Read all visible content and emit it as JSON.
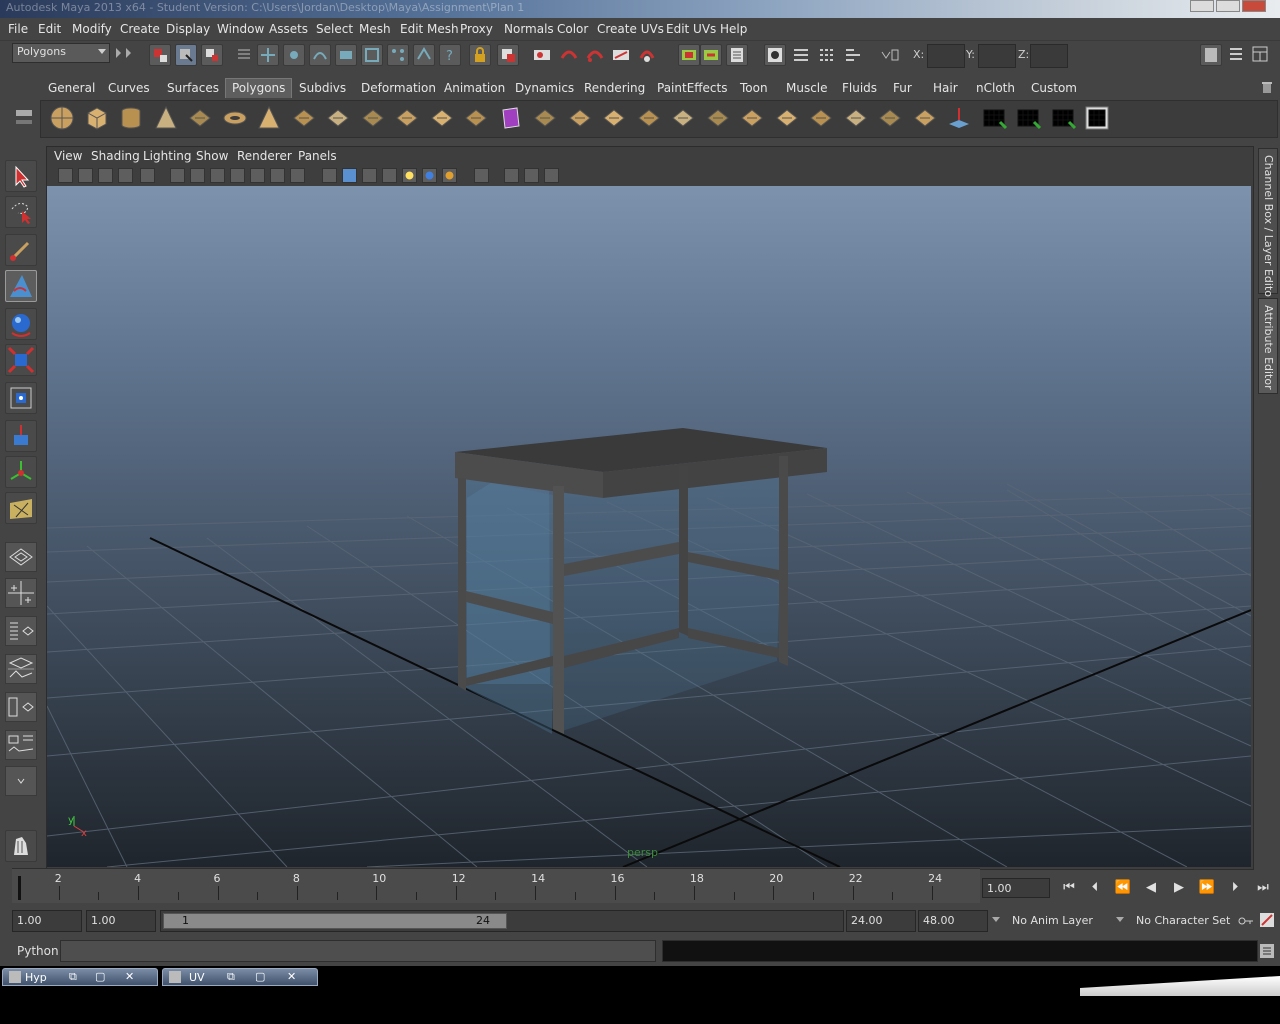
{
  "window": {
    "title": "Autodesk Maya 2013 x64 - Student Version: C:\\Users\\Jordan\\Desktop\\Maya\\Assignment\\Plan 1"
  },
  "menubar": {
    "items": [
      "File",
      "Edit",
      "Modify",
      "Create",
      "Display",
      "Window",
      "Assets",
      "Select",
      "Mesh",
      "Edit Mesh",
      "Proxy",
      "Normals",
      "Color",
      "Create UVs",
      "Edit UVs",
      "Help"
    ]
  },
  "statusline": {
    "menuset": "Polygons",
    "x_label": "X:",
    "y_label": "Y:",
    "z_label": "Z:"
  },
  "shelf": {
    "tabs": [
      "General",
      "Curves",
      "Surfaces",
      "Polygons",
      "Subdivs",
      "Deformation",
      "Animation",
      "Dynamics",
      "Rendering",
      "PaintEffects",
      "Toon",
      "Muscle",
      "Fluids",
      "Fur",
      "Hair",
      "nCloth",
      "Custom"
    ],
    "active_tab": "Polygons",
    "icons": [
      "sphere-icon",
      "cube-icon",
      "cylinder-icon",
      "cone-icon",
      "plane-icon",
      "torus-icon",
      "pyramid-icon",
      "pipe-icon",
      "soccer-ball-icon",
      "combine-icon",
      "separate-icon",
      "smooth-icon",
      "mirror-icon",
      "bevel-icon",
      "extrude-icon",
      "bridge-icon",
      "append-icon",
      "split-icon",
      "insert-edge-loop-icon",
      "wedge-icon",
      "fill-hole-icon",
      "reduce-icon",
      "cleanup-icon",
      "triangulate-icon",
      "quadrangulate-icon",
      "sculpt-icon",
      "planar-map-icon",
      "cylindrical-map-icon",
      "spherical-map-icon",
      "automatic-map-icon",
      "uv-editor-icon"
    ]
  },
  "viewport": {
    "menu": [
      "View",
      "Shading",
      "Lighting",
      "Show",
      "Renderer",
      "Panels"
    ],
    "camera_label": "persp",
    "axis_y": "y",
    "axis_x": "x"
  },
  "right_tabs": {
    "channel_box": "Channel Box / Layer Editor",
    "attribute_editor": "Attribute Editor"
  },
  "timeline": {
    "ticks": [
      "2",
      "4",
      "6",
      "8",
      "10",
      "12",
      "14",
      "16",
      "18",
      "20",
      "22",
      "24"
    ],
    "current_frame": "1.00"
  },
  "range": {
    "start_time": "1.00",
    "playback_start": "1.00",
    "range_start_label": "1",
    "range_end_label": "24",
    "playback_end": "24.00",
    "end_time": "48.00",
    "anim_layer": "No Anim Layer",
    "character_set": "No Character Set"
  },
  "cmdline": {
    "language": "Python"
  },
  "taskbar": {
    "items": [
      "Hyp",
      "UV"
    ]
  },
  "colors": {
    "ui_bg": "#444444",
    "viewport_top": "#7d93ad",
    "viewport_bottom": "#1f252c",
    "table": "#4a4a4a"
  }
}
